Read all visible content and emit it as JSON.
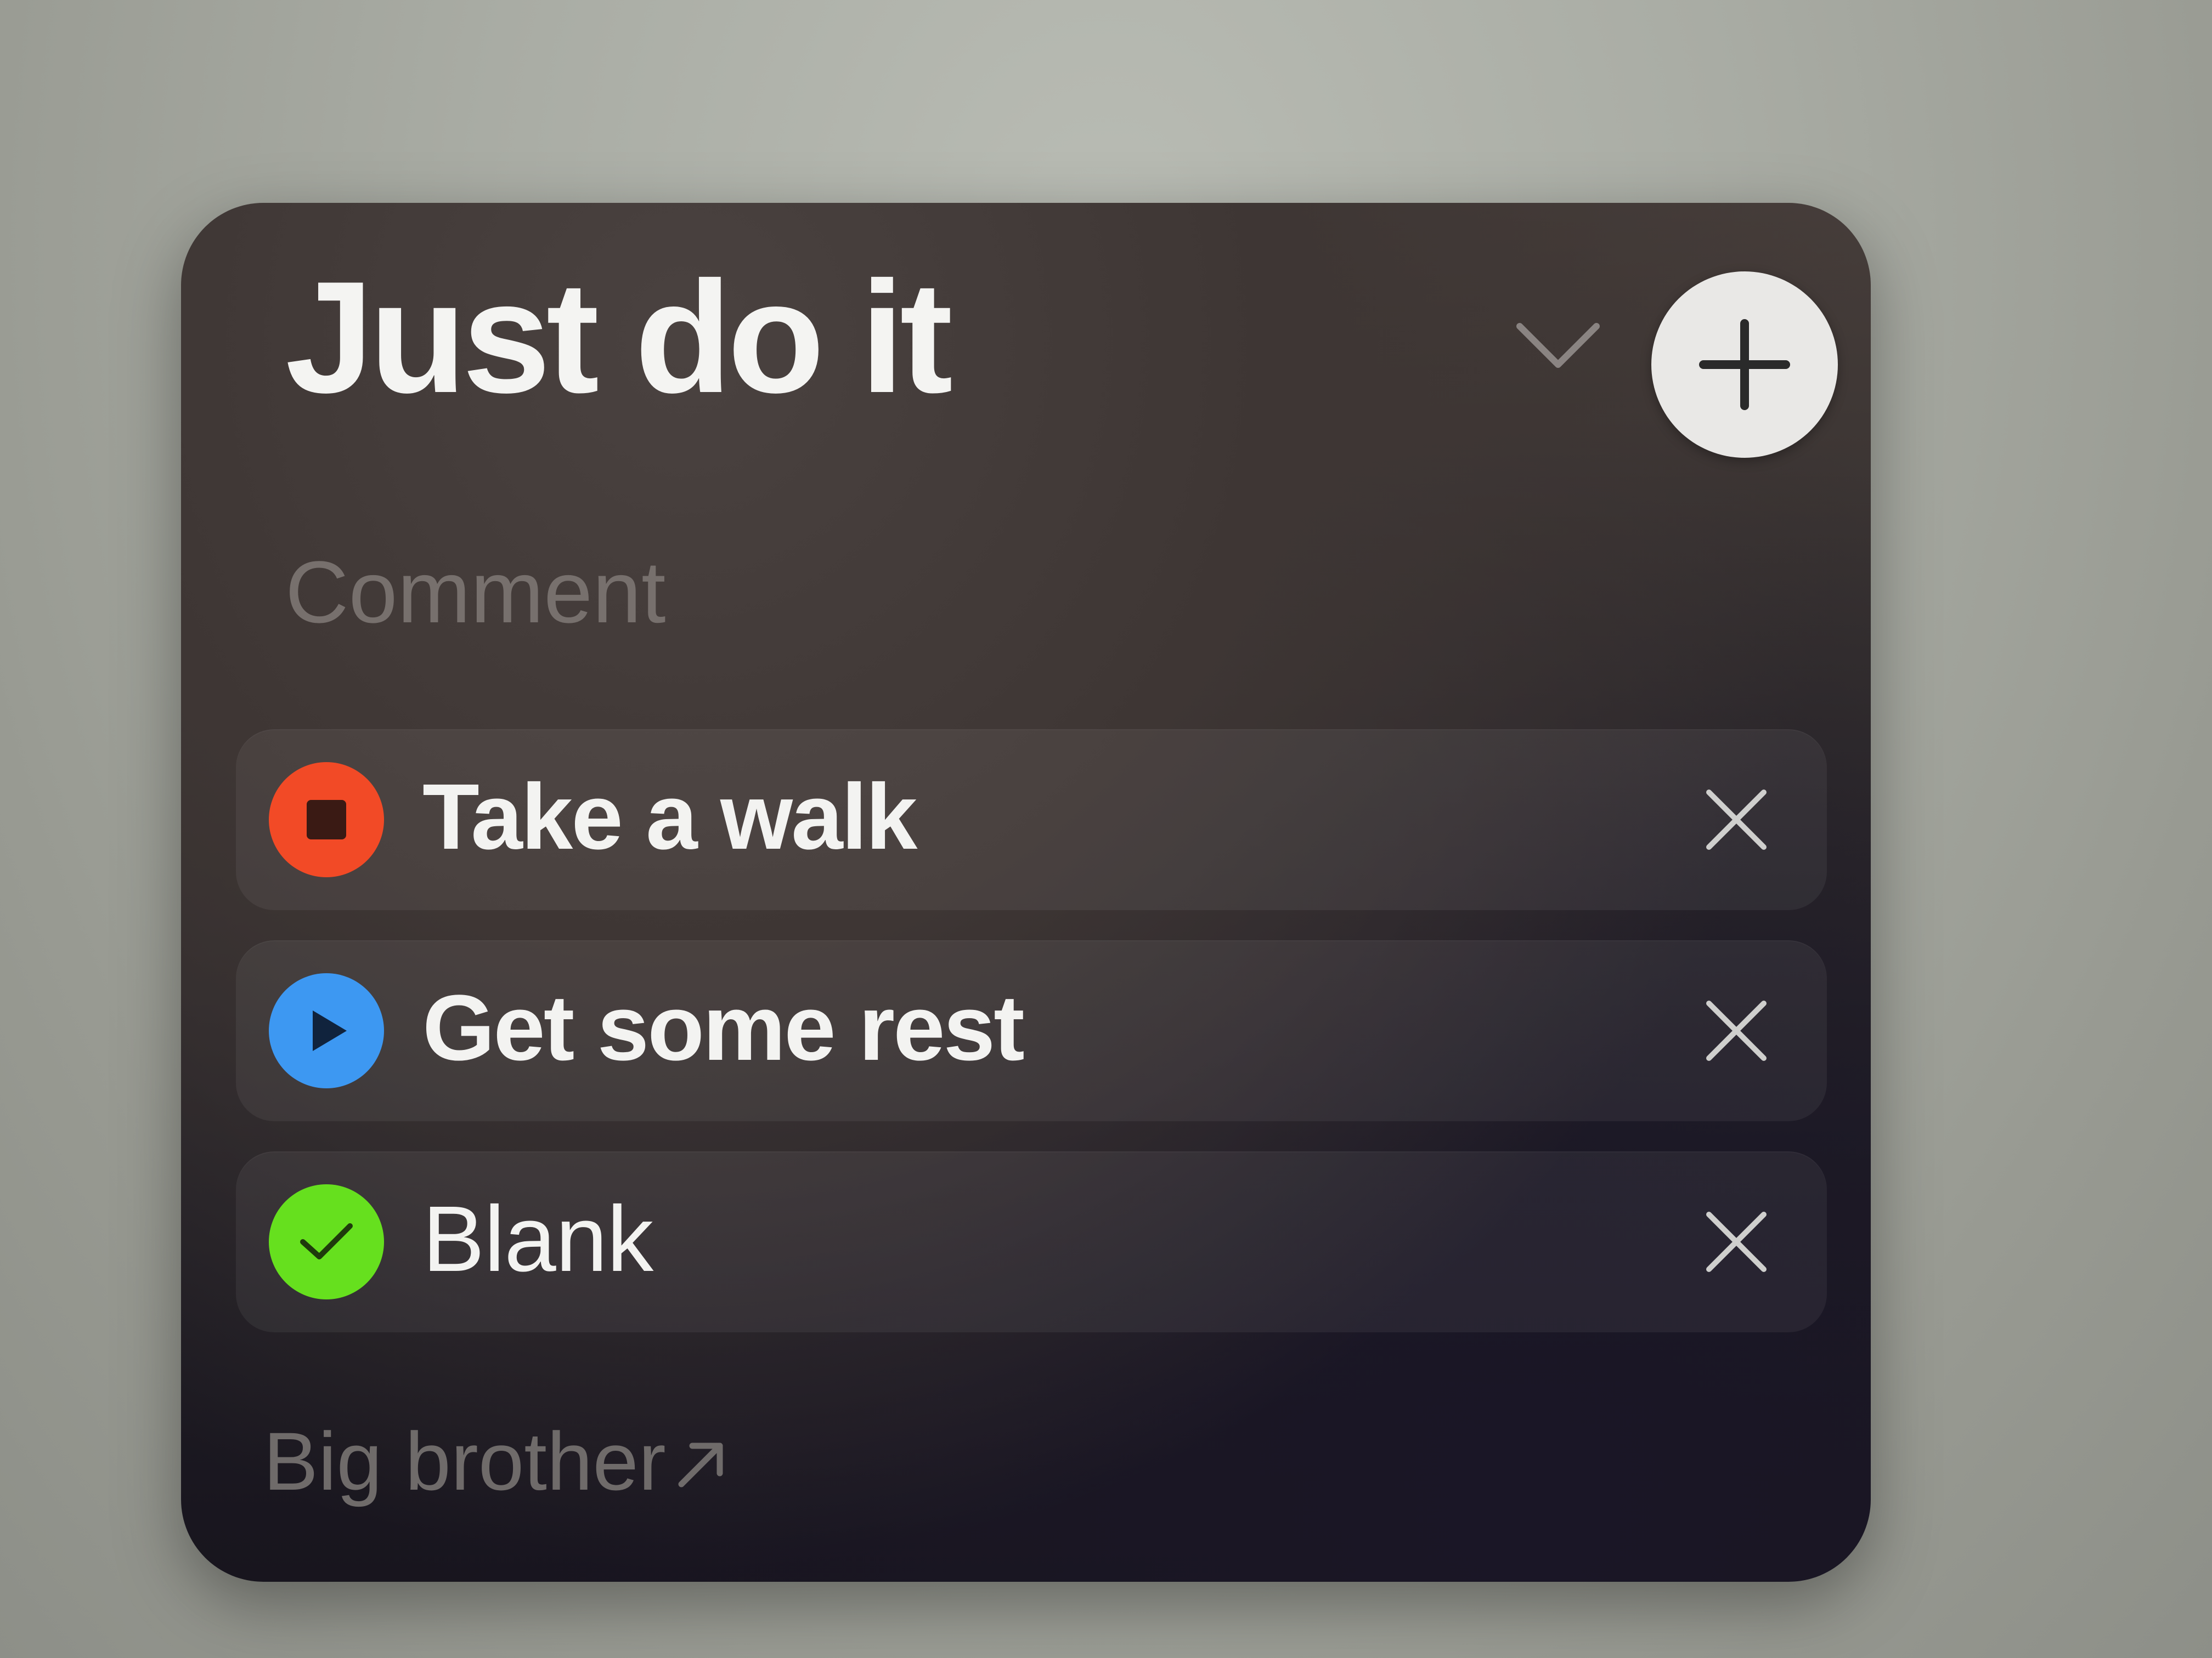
{
  "widget": {
    "title": "Just do it",
    "comment_placeholder": "Comment",
    "footer_link_label": "Big brother",
    "icons": {
      "collapse": "chevron-down-icon",
      "add": "plus-icon",
      "remove": "close-icon",
      "external": "arrow-up-right-icon"
    },
    "tasks": [
      {
        "label": "Take a walk",
        "status": "stopped",
        "status_icon": "stop-icon",
        "status_color": "#f24a26"
      },
      {
        "label": "Get some rest",
        "status": "paused",
        "status_icon": "play-icon",
        "status_color": "#3d98f2"
      },
      {
        "label": "Blank",
        "status": "done",
        "status_icon": "check-icon",
        "status_color": "#66e01e"
      }
    ]
  }
}
